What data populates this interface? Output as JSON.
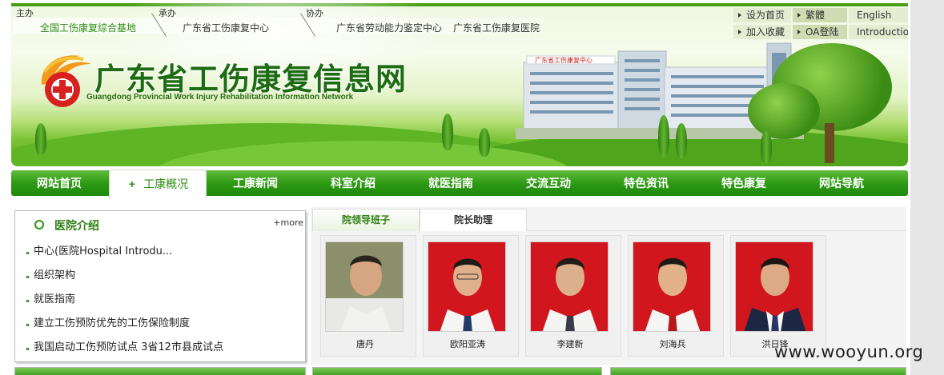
{
  "sponsors": {
    "host_label": "主办",
    "host_org": "全国工伤康复综合基地",
    "undertaker_label": "承办",
    "undertaker_org": "广东省工伤康复中心",
    "co_label": "协办",
    "co_org_1": "广东省劳动能力鉴定中心",
    "co_org_2": "广东省工伤康复医院"
  },
  "top_links": {
    "set_home": "设为首页",
    "traditional": "繁體",
    "english": "English",
    "add_favorite": "加入收藏",
    "oa_login": "OA登陆",
    "introduction": "Introduction"
  },
  "site": {
    "title": "广东省工伤康复信息网",
    "subtitle": "Guangdong Provincial Work Injury Rehabilitation Information Network"
  },
  "nav": {
    "items": [
      "网站首页",
      "工康概况",
      "工康新闻",
      "科室介绍",
      "就医指南",
      "交流互动",
      "特色资讯",
      "特色康复",
      "网站导航"
    ],
    "active_index": 1,
    "active_marker": "+"
  },
  "hospital_intro": {
    "title": "医院介绍",
    "more": "+more",
    "items": [
      "中心(医院Hospital Introdu...",
      "组织架构",
      "就医指南",
      "建立工伤预防优先的工伤保险制度",
      "我国启动工伤预防试点 3省12市县成试点"
    ]
  },
  "leaders": {
    "tabs": [
      "院领导班子",
      "院长助理"
    ],
    "active_tab": 0,
    "people": [
      "唐丹",
      "欧阳亚涛",
      "李建新",
      "刘海兵",
      "洪日锋"
    ]
  },
  "watermark": "www.wooyun.org",
  "colors": {
    "brand_green": "#2f9a15",
    "title_green": "#1d6c12",
    "photo_red": "#d1161d"
  }
}
